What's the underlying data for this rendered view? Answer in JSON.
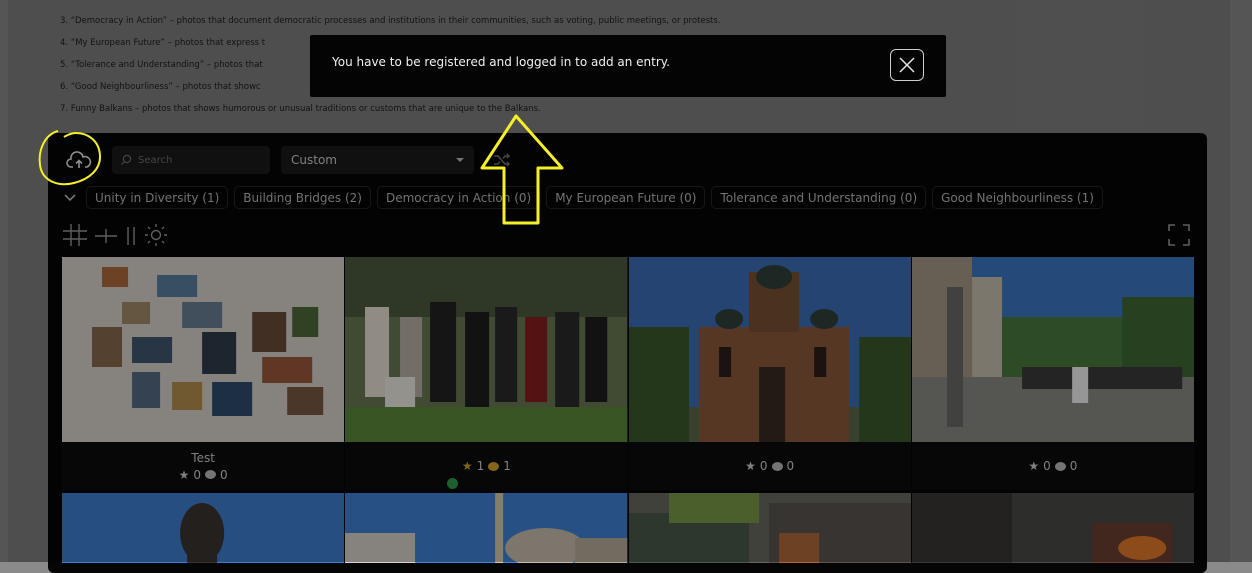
{
  "intro_items": [
    "3. “Democracy in Action” – photos that document democratic processes and institutions in their communities, such as voting, public meetings, or protests.",
    "4. “My European Future” – photos that express t",
    "5. “Tolerance and Understanding” – photos that",
    "6. “Good Neighbourliness” – photos that showc",
    "7. Funny Balkans – photos that shows humorous or unusual traditions or customs that are unique to the Balkans."
  ],
  "toast": {
    "message": "You have to be registered and logged in to add an entry."
  },
  "toolbar": {
    "search_placeholder": "Search",
    "sort_value": "Custom"
  },
  "categories": [
    {
      "label": "Unity in Diversity (1)"
    },
    {
      "label": "Building Bridges (2)"
    },
    {
      "label": "Democracy in Action (0)"
    },
    {
      "label": "My European Future (0)"
    },
    {
      "label": "Tolerance and Understanding (0)"
    },
    {
      "label": "Good Neighbourliness (1)"
    }
  ],
  "cards": [
    {
      "title": "Test",
      "stars": "0",
      "comments": "0"
    },
    {
      "title": "",
      "stars": "1",
      "comments": "1"
    },
    {
      "title": "",
      "stars": "0",
      "comments": "0"
    },
    {
      "title": "",
      "stars": "0",
      "comments": "0"
    }
  ],
  "colors": {
    "annotation": "#f5ef2a",
    "accent_gold": "#d4a52b",
    "status_green": "#2f9c4a"
  }
}
